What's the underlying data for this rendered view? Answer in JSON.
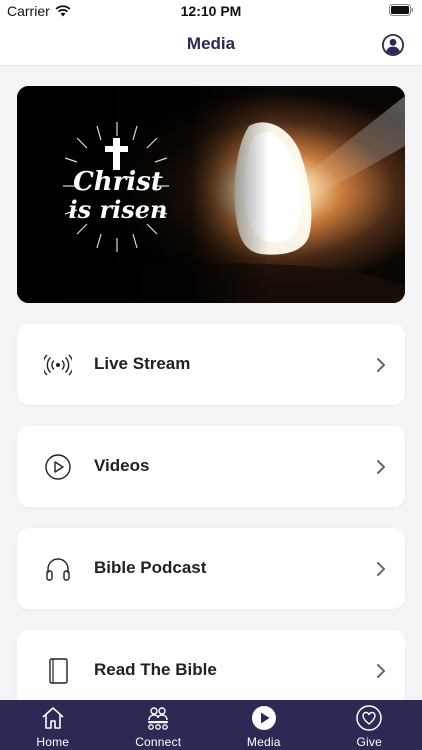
{
  "status_bar": {
    "carrier": "Carrier",
    "time": "12:10 PM"
  },
  "nav": {
    "title": "Media"
  },
  "hero": {
    "image_text_line1": "Christ",
    "image_text_line2": "is risen"
  },
  "menu": [
    {
      "label": "Live Stream",
      "icon": "broadcast-icon"
    },
    {
      "label": "Videos",
      "icon": "play-circle-icon"
    },
    {
      "label": "Bible Podcast",
      "icon": "headphones-icon"
    },
    {
      "label": "Read The Bible",
      "icon": "book-icon"
    }
  ],
  "tabs": [
    {
      "label": "Home",
      "icon": "home-icon",
      "active": false
    },
    {
      "label": "Connect",
      "icon": "people-icon",
      "active": false
    },
    {
      "label": "Media",
      "icon": "play-circle-icon",
      "active": true
    },
    {
      "label": "Give",
      "icon": "heart-icon",
      "active": false
    }
  ],
  "colors": {
    "brand": "#2b2a55",
    "background": "#f4f4f7",
    "card": "#ffffff",
    "tab_text": "#ffffff"
  }
}
